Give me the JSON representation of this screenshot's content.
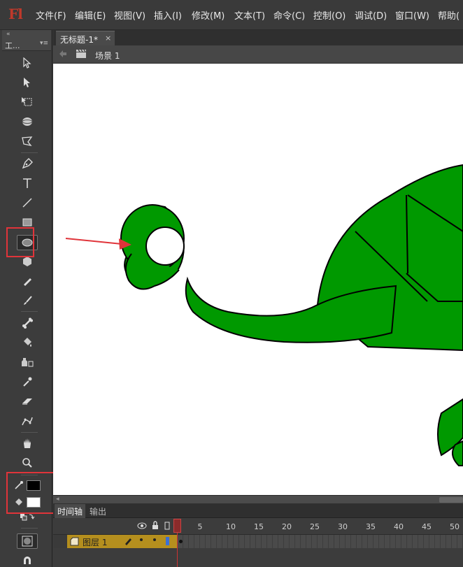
{
  "app": {
    "logo": "Fl"
  },
  "menu": [
    "文件(F)",
    "编辑(E)",
    "视图(V)",
    "插入(I)",
    "修改(M)",
    "文本(T)",
    "命令(C)",
    "控制(O)",
    "调试(D)",
    "窗口(W)",
    "帮助("
  ],
  "toolbox": {
    "title": "工..."
  },
  "document": {
    "tab_title": "无标题-1*",
    "close_glyph": "×",
    "scene": "场景 1"
  },
  "timeline": {
    "tabs": [
      "时间轴",
      "输出"
    ],
    "frame_numbers": [
      "1",
      "5",
      "10",
      "15",
      "20",
      "25",
      "30",
      "35",
      "40",
      "45",
      "50"
    ],
    "layer_name": "图层 1",
    "current_frame": 1
  },
  "colors": {
    "stroke_color": "#000000",
    "fill_color": "#ffffff",
    "shape_fill": "#009900",
    "highlight": "#e0343a"
  },
  "icons": {
    "tools": [
      "selection-tool-icon",
      "subselection-tool-icon",
      "free-transform-icon",
      "3d-rotation-icon",
      "lasso-icon",
      "pen-icon",
      "text-icon",
      "line-icon",
      "rectangle-icon",
      "oval-icon",
      "polystar-icon",
      "pencil-icon",
      "brush-icon",
      "bone-icon",
      "paint-bucket-icon",
      "ink-bottle-icon",
      "eyedropper-icon",
      "eraser-icon",
      "deco-icon",
      "hand-icon",
      "zoom-icon"
    ]
  }
}
